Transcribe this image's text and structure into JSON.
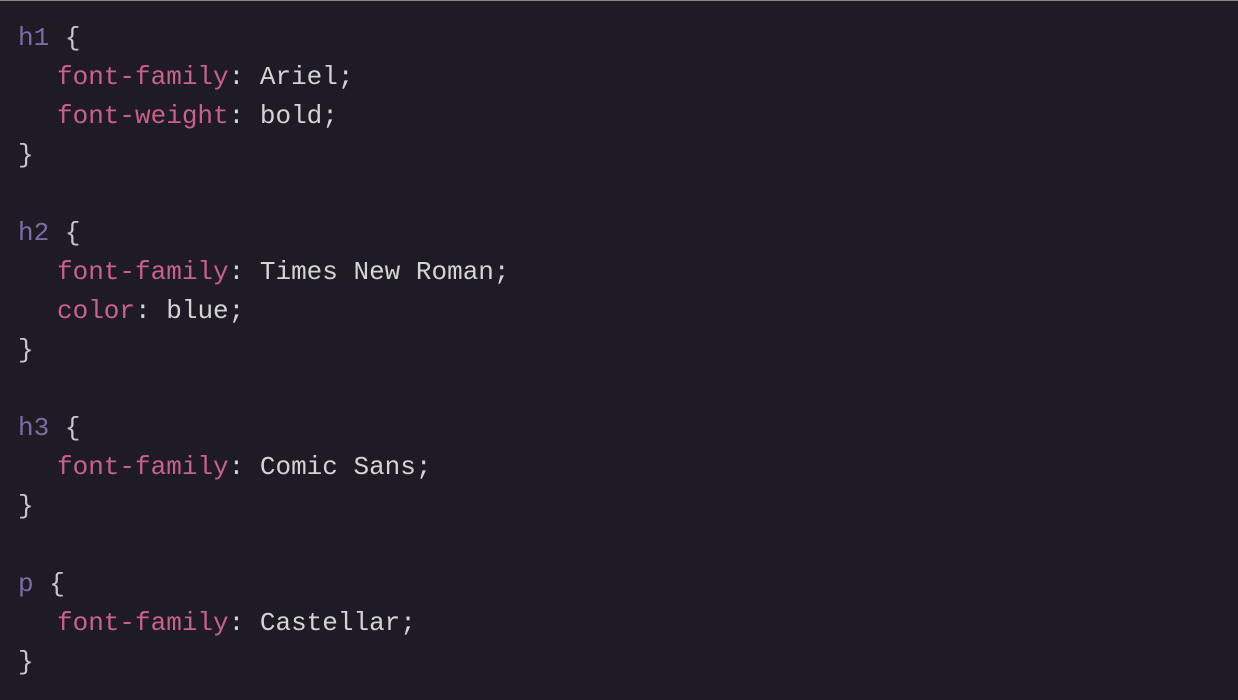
{
  "code": {
    "rules": [
      {
        "selector": "h1",
        "declarations": [
          {
            "property": "font-family",
            "value": "Ariel"
          },
          {
            "property": "font-weight",
            "value": "bold"
          }
        ]
      },
      {
        "selector": "h2",
        "declarations": [
          {
            "property": "font-family",
            "value": "Times New Roman"
          },
          {
            "property": "color",
            "value": "blue"
          }
        ]
      },
      {
        "selector": "h3",
        "declarations": [
          {
            "property": "font-family",
            "value": "Comic Sans"
          }
        ]
      },
      {
        "selector": "p",
        "declarations": [
          {
            "property": "font-family",
            "value": "Castellar"
          }
        ]
      }
    ]
  }
}
